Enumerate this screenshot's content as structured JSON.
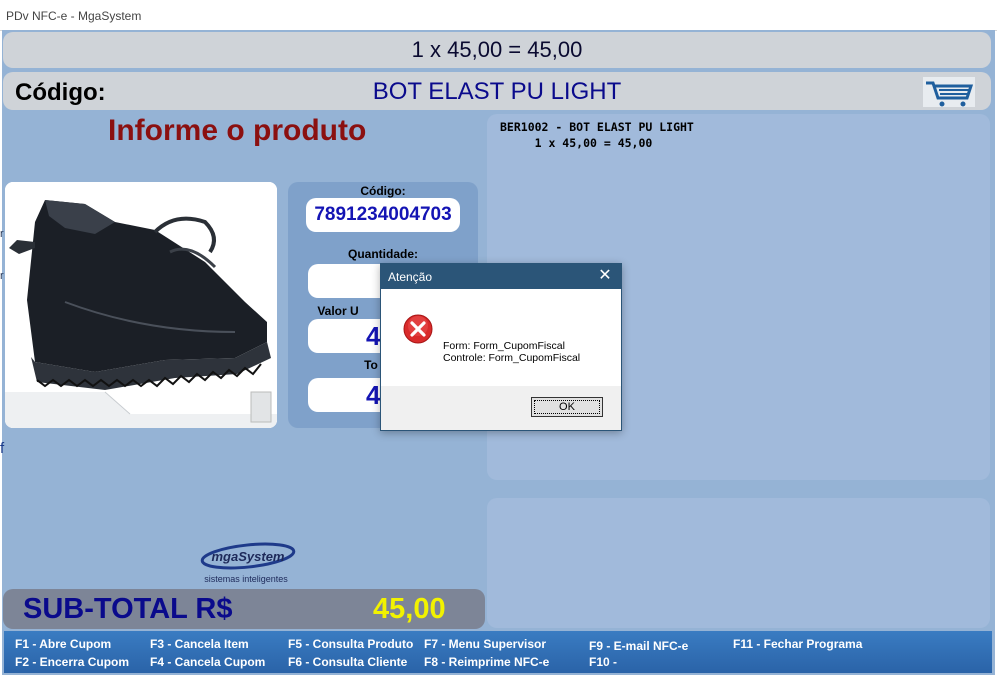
{
  "window": {
    "title": "PDv NFC-e - MgaSystem"
  },
  "calc_line": "1 x 45,00 = 45,00",
  "code_bar": {
    "label": "Código:",
    "product_name": "BOT ELAST PU LIGHT",
    "icon": "cart-icon"
  },
  "prompt": "Informe o produto",
  "form": {
    "codigo_label": "Código:",
    "codigo_value": "7891234004703",
    "quantidade_label": "Quantidade:",
    "valor_unit_label": "Valor U",
    "valor_unit_partial": "4",
    "total_label": "To",
    "total_partial": "4"
  },
  "receipt": {
    "line1": "BER1002 - BOT ELAST PU LIGHT",
    "line2": "     1 x 45,00 = 45,00"
  },
  "logo": {
    "name": "mgaSystem",
    "tagline": "sistemas inteligentes"
  },
  "subtotal": {
    "label": "SUB-TOTAL R$",
    "value": "45,00"
  },
  "function_keys": [
    "F1 - Abre Cupom",
    "F2 - Encerra Cupom",
    "F3 - Cancela Item",
    "F4 - Cancela Cupom",
    "F5 - Consulta Produto",
    "F6 - Consulta Cliente",
    "F7 - Menu Supervisor",
    "F8 - Reimprime NFC-e",
    "F9    - E-mail NFC-e",
    "F10  -",
    "F11  - Fechar Programa"
  ],
  "dialog": {
    "title": "Atenção",
    "icon": "error-icon",
    "line1": "Form: Form_CupomFiscal",
    "line2": "Controle: Form_CupomFiscal",
    "ok": "OK"
  },
  "colors": {
    "background": "#95b3d5",
    "dialog_title": "#2b5578",
    "prompt": "#8b1010",
    "subtotal_value": "#f2f200",
    "function_bar": "#2a63a8"
  }
}
